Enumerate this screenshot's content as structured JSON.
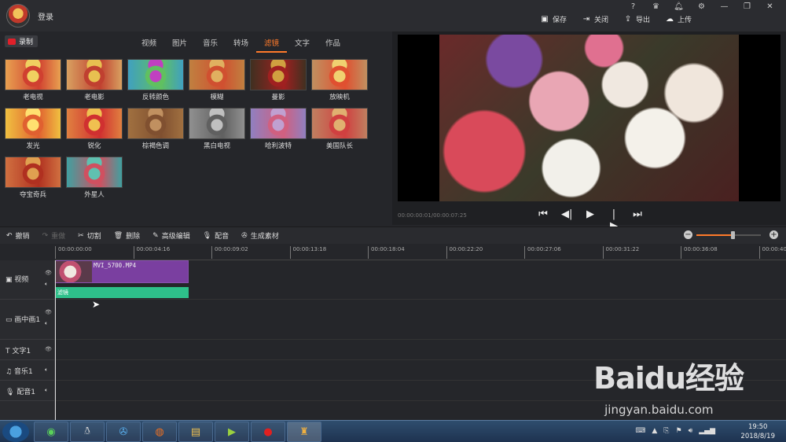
{
  "titlebar": {
    "login": "登录",
    "sys": [
      "?",
      "VIP",
      "bell-icon",
      "gear-icon",
      "minimize",
      "restore",
      "close"
    ],
    "actions": [
      {
        "label": "保存",
        "icon": "save-icon"
      },
      {
        "label": "关闭",
        "icon": "exit-icon"
      },
      {
        "label": "导出",
        "icon": "export-icon"
      },
      {
        "label": "上传",
        "icon": "upload-icon"
      }
    ]
  },
  "library": {
    "record_label": "录制",
    "tabs": [
      "视频",
      "图片",
      "音乐",
      "转场",
      "滤镜",
      "文字",
      "作品"
    ],
    "active_tab": "滤镜",
    "filters": [
      "老电视",
      "老电影",
      "反转颜色",
      "模糊",
      "曼影",
      "放映机",
      "发光",
      "锐化",
      "棕褐色调",
      "黑白电视",
      "哈利波特",
      "美国队长",
      "夺宝奇兵",
      "外星人"
    ]
  },
  "preview": {
    "timecode": "00:00:00:01/00:00:07:25",
    "controls": [
      "skip-start-icon",
      "step-back-icon",
      "play-icon",
      "step-forward-icon",
      "skip-end-icon"
    ]
  },
  "edit_toolbar": {
    "items": [
      {
        "label": "撤销",
        "icon": "undo-icon",
        "enabled": true
      },
      {
        "label": "重做",
        "icon": "redo-icon",
        "enabled": false
      },
      {
        "label": "切割",
        "icon": "scissors-icon",
        "enabled": true
      },
      {
        "label": "删除",
        "icon": "trash-icon",
        "enabled": true
      },
      {
        "label": "高级编辑",
        "icon": "edit-icon",
        "enabled": true
      },
      {
        "label": "配音",
        "icon": "mic-icon",
        "enabled": true
      },
      {
        "label": "生成素材",
        "icon": "film-reel-icon",
        "enabled": true
      }
    ],
    "zoom_level": 0.56
  },
  "timeline": {
    "ticks": [
      "00:00:00:00",
      "00:00:04:16",
      "00:00:09:02",
      "00:00:13:18",
      "00:00:18:04",
      "00:00:22:20",
      "00:00:27:06",
      "00:00:31:22",
      "00:00:36:08",
      "00:00:40"
    ],
    "tracks": [
      {
        "name": "视频",
        "icon": "play-icon"
      },
      {
        "name": "画中画1",
        "icon": "pip-icon"
      },
      {
        "name": "文字1",
        "icon": "text-icon"
      },
      {
        "name": "音乐1",
        "icon": "music-icon"
      },
      {
        "name": "配音1",
        "icon": "mic-icon"
      }
    ],
    "video_clip": "MVI_5700.MP4",
    "filter_clip": "滤镜"
  },
  "taskbar": {
    "time": "19:50",
    "date": "2018/8/19"
  },
  "watermark": {
    "text": "Baidu经验",
    "url": "jingyan.baidu.com"
  }
}
